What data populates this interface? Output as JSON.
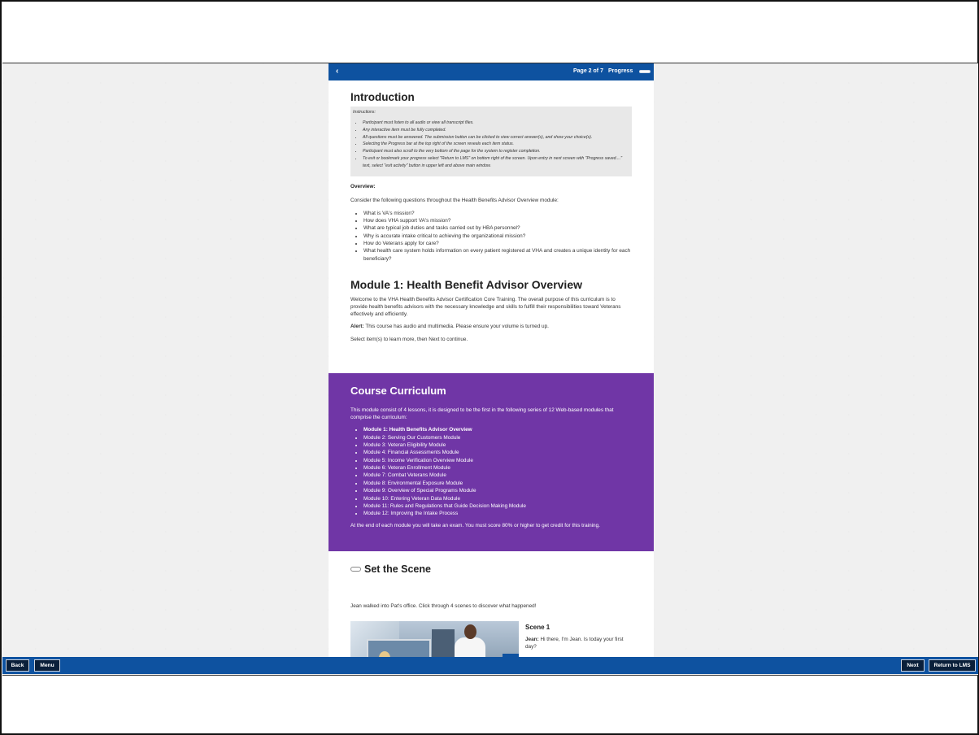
{
  "topbar": {
    "back_glyph": "‹",
    "page_info": "Page 2 of 7",
    "progress_label": "Progress",
    "progress_value": 0
  },
  "intro": {
    "title": "Introduction",
    "instructions_label": "Instructions:",
    "instructions": [
      "Participant must listen to all audio or view all transcript files.",
      "Any interactive item must be fully completed.",
      "All questions must be answered. The submission button can be clicked to view correct answer(s), and show your choice(s).",
      "Selecting the Progress bar at the top right of the screen reveals each item status.",
      "Participant must also scroll to the very bottom of the page for the system to register completion.",
      "To exit or bookmark your progress select \"Return to LMS\" on bottom right of the screen. Upon entry in next screen with \"Progress saved....\" text, select \"exit activity\" button in upper left and above main window."
    ],
    "overview_label": "Overview:",
    "overview_text": "Consider the following questions throughout the Health Benefits Advisor Overview module:",
    "questions": [
      "What is VA's mission?",
      "How does VHA support VA's mission?",
      "What are typical job duties and tasks carried out by HBA personnel?",
      "Why is accurate intake critical to achieving the organizational mission?",
      "How do Veterans apply for care?",
      "What health care system holds information on every patient registered at VHA and creates a unique identity for each beneficiary?"
    ]
  },
  "module": {
    "title": "Module 1: Health Benefit Advisor Overview",
    "welcome": "Welcome to the VHA Health Benefits Advisor Certification Core Training. The overall purpose of this curriculum is to provide health benefits advisors with the necessary knowledge and skills to fulfill their responsibilities toward Veterans effectively and efficiently.",
    "alert_label": "Alert:",
    "alert_text": " This course has audio and multimedia. Please ensure your volume is turned up.",
    "select_text": "Select item(s) to learn more, then Next to continue."
  },
  "curriculum": {
    "title": "Course Curriculum",
    "intro": "This module consist of 4 lessons, it is designed to be the first in the following series of 12 Web-based modules that comprise the curriculum:",
    "modules": [
      "Module 1: Health Benefits Advisor Overview",
      "Module 2: Serving Our Customers Module",
      "Module 3: Veteran Eligibility Module",
      "Module 4: Financial Assessments Module",
      "Module 5: Income Verification Overview Module",
      "Module 6: Veteran Enrollment Module",
      "Module 7: Combat Veterans Module",
      "Module 8: Environmental Exposure Module",
      "Module 9: Overview of Special Programs Module",
      "Module 10: Entering Veteran Data Module",
      "Module 11: Rules and Regulations that Guide Decision Making Module",
      "Module 12: Improving the Intake Process"
    ],
    "end_text": "At the end of each module you will take an exam. You must score 80% or higher to get credit for this training."
  },
  "scene": {
    "title": "Set the Scene",
    "intro": "Jean walked into Pat's office. Click through 4 scenes to discover what happened!",
    "scene_title": "Scene 1",
    "speaker": "Jean:",
    "line": " Hi there, I'm Jean. Is today your first day?",
    "next_glyph": "›"
  },
  "bottombar": {
    "back": "Back",
    "menu": "Menu",
    "next": "Next",
    "return": "Return to LMS"
  },
  "colors": {
    "primary_blue": "#0e52a0",
    "curriculum_purple": "#7036a6",
    "button_dark": "#0a1f3a"
  }
}
